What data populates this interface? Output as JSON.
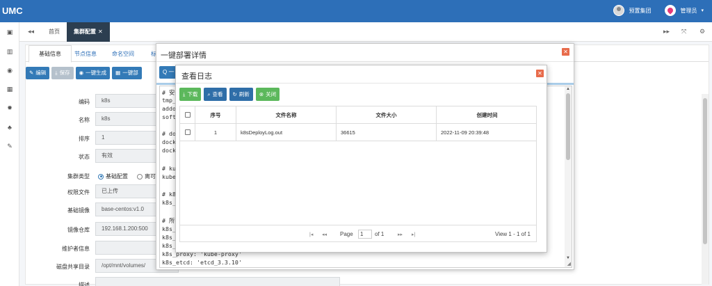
{
  "topbar": {
    "logo": "UMC",
    "cluster_label": "预置集团",
    "user_label": "管理员",
    "caret": "▾"
  },
  "tabstrip": {
    "back_icon": "◂◂",
    "home": "首页",
    "active_tab": "集群配置",
    "close": "✕",
    "forward_icon": "▸▸",
    "fullscreen_icon": "⤧",
    "settings_icon": "⚙"
  },
  "leftbar": [
    "▣",
    "▥",
    "◉",
    "▦",
    "✹",
    "♣",
    "✎"
  ],
  "page": {
    "subtabs": [
      "基础信息",
      "节点信息",
      "命名空间",
      "标"
    ],
    "buttons": [
      "编辑",
      "保存",
      "一键生成",
      "一键部"
    ],
    "form": [
      {
        "label": "编码",
        "value": "k8s"
      },
      {
        "label": "名称",
        "value": "k8s"
      },
      {
        "label": "排序",
        "value": "1"
      },
      {
        "label": "状态",
        "value": "有效"
      },
      {
        "label": "集群类型",
        "radio1": "基础配置",
        "radio2": "离可"
      },
      {
        "label": "权限文件",
        "value": "已上传"
      },
      {
        "label": "基础镜像",
        "value": "base-centos:v1.0"
      },
      {
        "label": "镜像仓库",
        "value": "192.168.1.200:500"
      },
      {
        "label": "维护者信息",
        "value": ""
      },
      {
        "label": "磁盘共享目录",
        "value": "/opt/mnt/volumes/"
      },
      {
        "label": "描述",
        "value": ""
      }
    ]
  },
  "dialog1": {
    "title": "一键部署详情",
    "tool_label": "Q 一",
    "code_lines": [
      "# 安装",
      "tmp_",
      "addo",
      "softw",
      "",
      "# doc",
      "docke",
      "docke",
      "",
      "# kul",
      "kube_",
      "",
      "# k8s",
      "k8s_v",
      "",
      "# 所有",
      "k8s_a",
      "k8s_c",
      "k8s_s",
      "k8s_proxy: 'kube-proxy'",
      "k8s_etcd: 'etcd_3.3.10'"
    ]
  },
  "dialog2": {
    "title": "查看日志",
    "buttons": {
      "download": "下载",
      "view": "查看",
      "refresh": "刷新",
      "close": "关闭"
    },
    "columns": [
      "序号",
      "文件名称",
      "文件大小",
      "创建时间"
    ],
    "rows": [
      {
        "index": "1",
        "name": "k8sDeployLog.out",
        "size": "36615",
        "created": "2022-11-09 20:39:48"
      }
    ],
    "pager": {
      "page_label": "Page",
      "page_value": "1",
      "of_label": "of 1",
      "view_text": "View 1 - 1 of 1",
      "first": "|◂",
      "prev": "◂◂",
      "next": "▸▸",
      "last": "▸|"
    }
  }
}
